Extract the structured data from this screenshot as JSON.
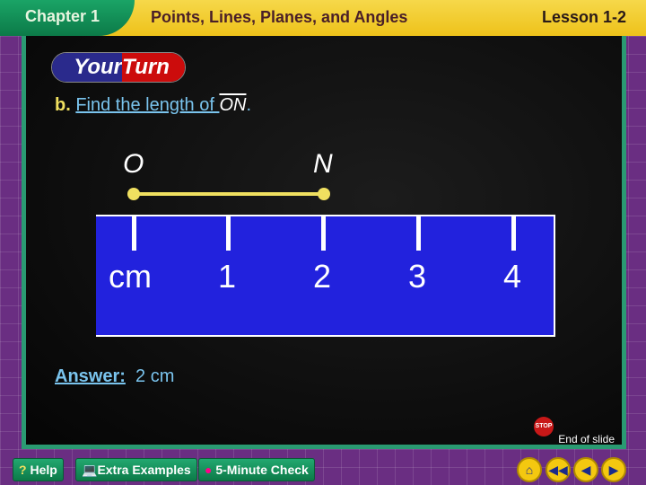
{
  "header": {
    "chapter": "Chapter 1",
    "title": "Points, Lines, Planes, and Angles",
    "lesson": "Lesson 1-2"
  },
  "banner": {
    "your": "Your",
    "turn": "Turn"
  },
  "question": {
    "label": "b.",
    "text": "Find the length of ",
    "segment": "ON",
    "period": "."
  },
  "figure": {
    "points": [
      "O",
      "N"
    ],
    "ruler_labels": [
      "cm",
      "1",
      "2",
      "3",
      "4"
    ],
    "ruler_color": "#2222dd",
    "segment_color": "#f0e060"
  },
  "answer": {
    "label": "Answer:",
    "value": "2 cm"
  },
  "end": {
    "stop": "STOP",
    "text": "End of slide"
  },
  "toolbar": {
    "help": "Help",
    "extra": "Extra Examples",
    "check": "5-Minute Check"
  },
  "nav": {
    "icons": [
      "home-icon",
      "first-icon",
      "previous-icon",
      "next-icon"
    ]
  }
}
